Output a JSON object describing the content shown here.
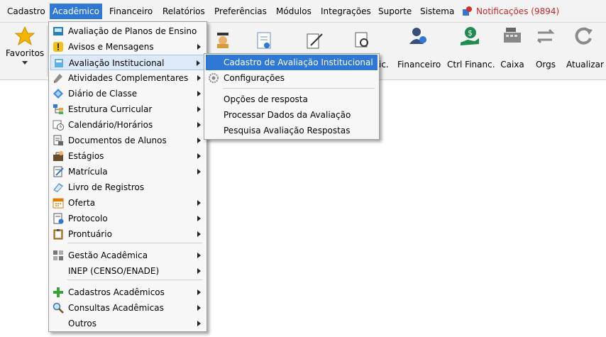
{
  "menubar": {
    "items": [
      "Cadastro",
      "Acadêmico",
      "Financeiro",
      "Relatórios",
      "Preferências",
      "Módulos",
      "Integrações",
      "Suporte",
      "Sistema"
    ],
    "notifications": "Notificações (9894)"
  },
  "toolbar": {
    "favoritos": "Favoritos",
    "partial_label": "ic.",
    "financeiro": "Financeiro",
    "ctrl_financ": "Ctrl Financ.",
    "caixa": "Caixa",
    "orgs": "Orgs",
    "atualizar": "Atualizar"
  },
  "academico_menu": {
    "items": [
      {
        "label": "Avaliação de Planos de Ensino",
        "icon": "plan-evaluation-icon"
      },
      {
        "label": "Avisos e Mensagens",
        "icon": "warning-icon"
      },
      {
        "label": "Avaliação Institucional",
        "icon": "institutional-evaluation-icon"
      },
      {
        "label": "Atividades Complementares",
        "icon": "activities-icon"
      },
      {
        "label": "Diário de Classe",
        "icon": "class-diary-icon"
      },
      {
        "label": "Estrutura Curricular",
        "icon": "curriculum-structure-icon"
      },
      {
        "label": "Calendário/Horários",
        "icon": "calendar-clock-icon"
      },
      {
        "label": "Documentos de Alunos",
        "icon": "student-documents-icon"
      },
      {
        "label": "Estágios",
        "icon": "internship-icon"
      },
      {
        "label": "Matrícula",
        "icon": "enrollment-icon"
      },
      {
        "label": "Livro de Registros",
        "icon": "record-book-icon"
      },
      {
        "label": "Oferta",
        "icon": "offer-calendar-icon"
      },
      {
        "label": "Protocolo",
        "icon": "protocol-icon"
      },
      {
        "label": "Prontuário",
        "icon": "record-clipboard-icon"
      },
      {
        "label": "Gestão Acadêmica",
        "icon": "management-icon"
      },
      {
        "label": "INEP (CENSO/ENADE)",
        "icon": ""
      },
      {
        "label": "Cadastros Acadêmicos",
        "icon": "plus-icon"
      },
      {
        "label": "Consultas Acadêmicas",
        "icon": "magnifier-icon"
      },
      {
        "label": "Outros",
        "icon": ""
      }
    ]
  },
  "submenu": {
    "items": [
      "Cadastro de Avaliação Institucional",
      "Configurações",
      "Opções de resposta",
      "Processar Dados da Avaliação",
      "Pesquisa Avaliação Respostas"
    ]
  },
  "colors": {
    "accent": "#2f78d6",
    "notification": "#c62828",
    "menu_bg": "#f7f7f7"
  }
}
